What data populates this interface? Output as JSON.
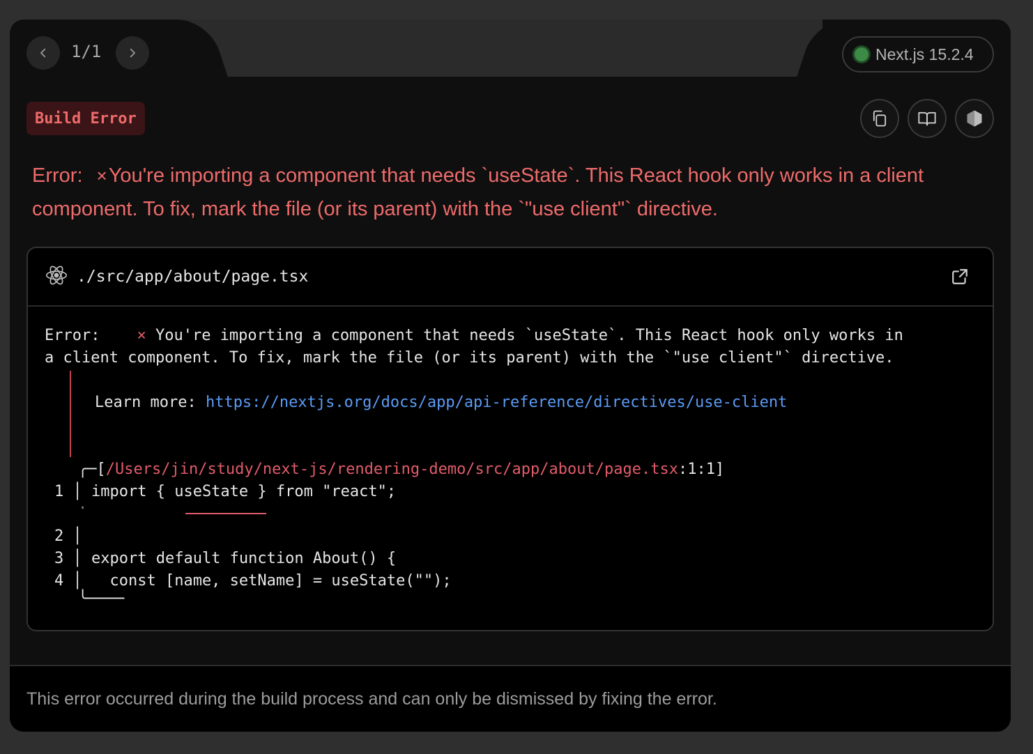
{
  "pager": {
    "label": "1/1"
  },
  "version": {
    "label": "Next.js 15.2.4",
    "status_color": "#3c8a45"
  },
  "badge": {
    "label": "Build Error"
  },
  "actions": {
    "copy_icon": "copy-icon",
    "docs_icon": "book-icon",
    "node_icon": "nodejs-icon"
  },
  "error": {
    "prefix": "Error:",
    "cross": "×",
    "message": "You're importing a component that needs `useState`. This React hook only works in a client component. To fix, mark the file (or its parent) with the `\"use client\"` directive."
  },
  "code_frame": {
    "file_path": "./src/app/about/page.tsx",
    "error_prefix": "Error:",
    "cross": "×",
    "line1": "You're importing a component that needs `useState`. This React hook only works in",
    "line2": "a client component. To fix, mark the file (or its parent) with the `\"use client\"` directive.",
    "learn_more_label": "Learn more:",
    "learn_more_url": "https://nextjs.org/docs/app/api-reference/directives/use-client",
    "location_open": "╭─[",
    "location_path": "/Users/jin/study/next-js/rendering-demo/src/app/about/page.tsx",
    "location_pos": ":1:1]",
    "code_lines": [
      {
        "num": "1",
        "text": "import { useState } from \"react\";"
      },
      {
        "num": "2",
        "text": ""
      },
      {
        "num": "3",
        "text": "export default function About() {"
      },
      {
        "num": "4",
        "text": "  const [name, setName] = useState(\"\");"
      }
    ],
    "dot": "·",
    "closing": "╰────"
  },
  "footer": {
    "text": "This error occurred during the build process and can only be dismissed by fixing the error."
  },
  "colors": {
    "error_red": "#ef6b6b",
    "link_blue": "#5b9bf5",
    "badge_bg": "#3a1416"
  }
}
